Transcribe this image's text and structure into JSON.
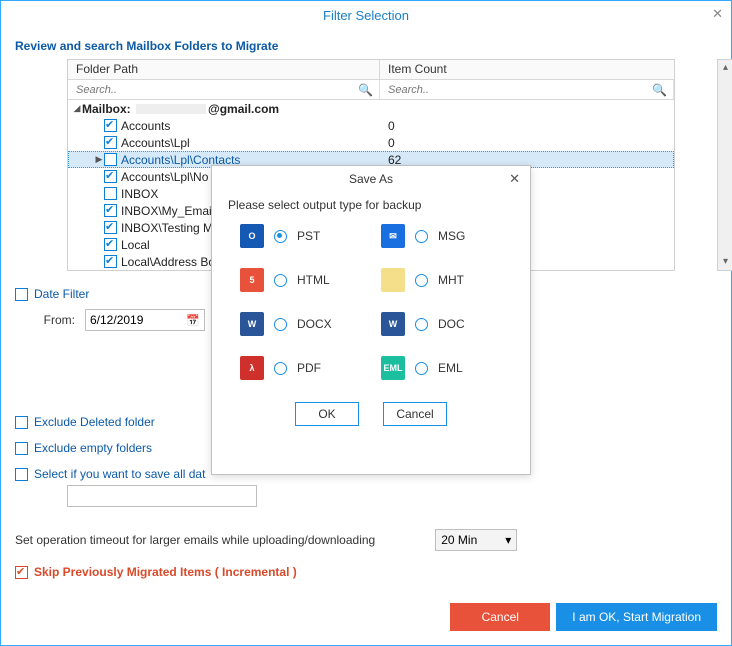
{
  "window": {
    "title": "Filter Selection"
  },
  "section_title": "Review and search Mailbox Folders to Migrate",
  "grid": {
    "col1": "Folder Path",
    "col2": "Item Count",
    "search_placeholder": "Search..",
    "mailbox_label": "Mailbox:",
    "mailbox_email": "@gmail.com",
    "rows": [
      {
        "label": "Accounts",
        "checked": true,
        "count": "0",
        "indent": 24
      },
      {
        "label": "Accounts\\Lpl",
        "checked": true,
        "count": "0",
        "indent": 24
      },
      {
        "label": "Accounts\\Lpl\\Contacts",
        "checked": false,
        "count": "62",
        "indent": 24,
        "selected": true,
        "caret": "▶"
      },
      {
        "label": "Accounts\\Lpl\\No",
        "checked": true,
        "indent": 24
      },
      {
        "label": "INBOX",
        "checked": false,
        "indent": 24
      },
      {
        "label": "INBOX\\My_Email",
        "checked": true,
        "indent": 24
      },
      {
        "label": "INBOX\\Testing M",
        "checked": true,
        "indent": 24
      },
      {
        "label": "Local",
        "checked": true,
        "indent": 24
      },
      {
        "label": "Local\\Address Bo",
        "checked": true,
        "indent": 24
      }
    ]
  },
  "date_filter": {
    "label": "Date Filter",
    "from_label": "From:",
    "from_value": "6/12/2019"
  },
  "options": {
    "exclude_deleted": "Exclude Deleted folder",
    "exclude_empty": "Exclude empty folders",
    "save_all": "Select if you want to save all dat"
  },
  "timeout": {
    "label": "Set operation timeout for larger emails while uploading/downloading",
    "value": "20 Min"
  },
  "skip": {
    "label": "Skip Previously Migrated Items ( Incremental )"
  },
  "footer": {
    "cancel": "Cancel",
    "ok": "I am OK, Start Migration"
  },
  "modal": {
    "title": "Save As",
    "subtitle": "Please select output type for backup",
    "formats": [
      {
        "name": "PST",
        "selected": true,
        "bg": "#1459b3",
        "txt": "O"
      },
      {
        "name": "MSG",
        "selected": false,
        "bg": "#1a6fe0",
        "txt": "✉"
      },
      {
        "name": "HTML",
        "selected": false,
        "bg": "#e8513a",
        "txt": "5"
      },
      {
        "name": "MHT",
        "selected": false,
        "bg": "#f5df8a",
        "txt": ""
      },
      {
        "name": "DOCX",
        "selected": false,
        "bg": "#2a5699",
        "txt": "W"
      },
      {
        "name": "DOC",
        "selected": false,
        "bg": "#2a5699",
        "txt": "W"
      },
      {
        "name": "PDF",
        "selected": false,
        "bg": "#d0302c",
        "txt": "λ"
      },
      {
        "name": "EML",
        "selected": false,
        "bg": "#1bbfa0",
        "txt": "EML"
      }
    ],
    "ok": "OK",
    "cancel": "Cancel"
  }
}
